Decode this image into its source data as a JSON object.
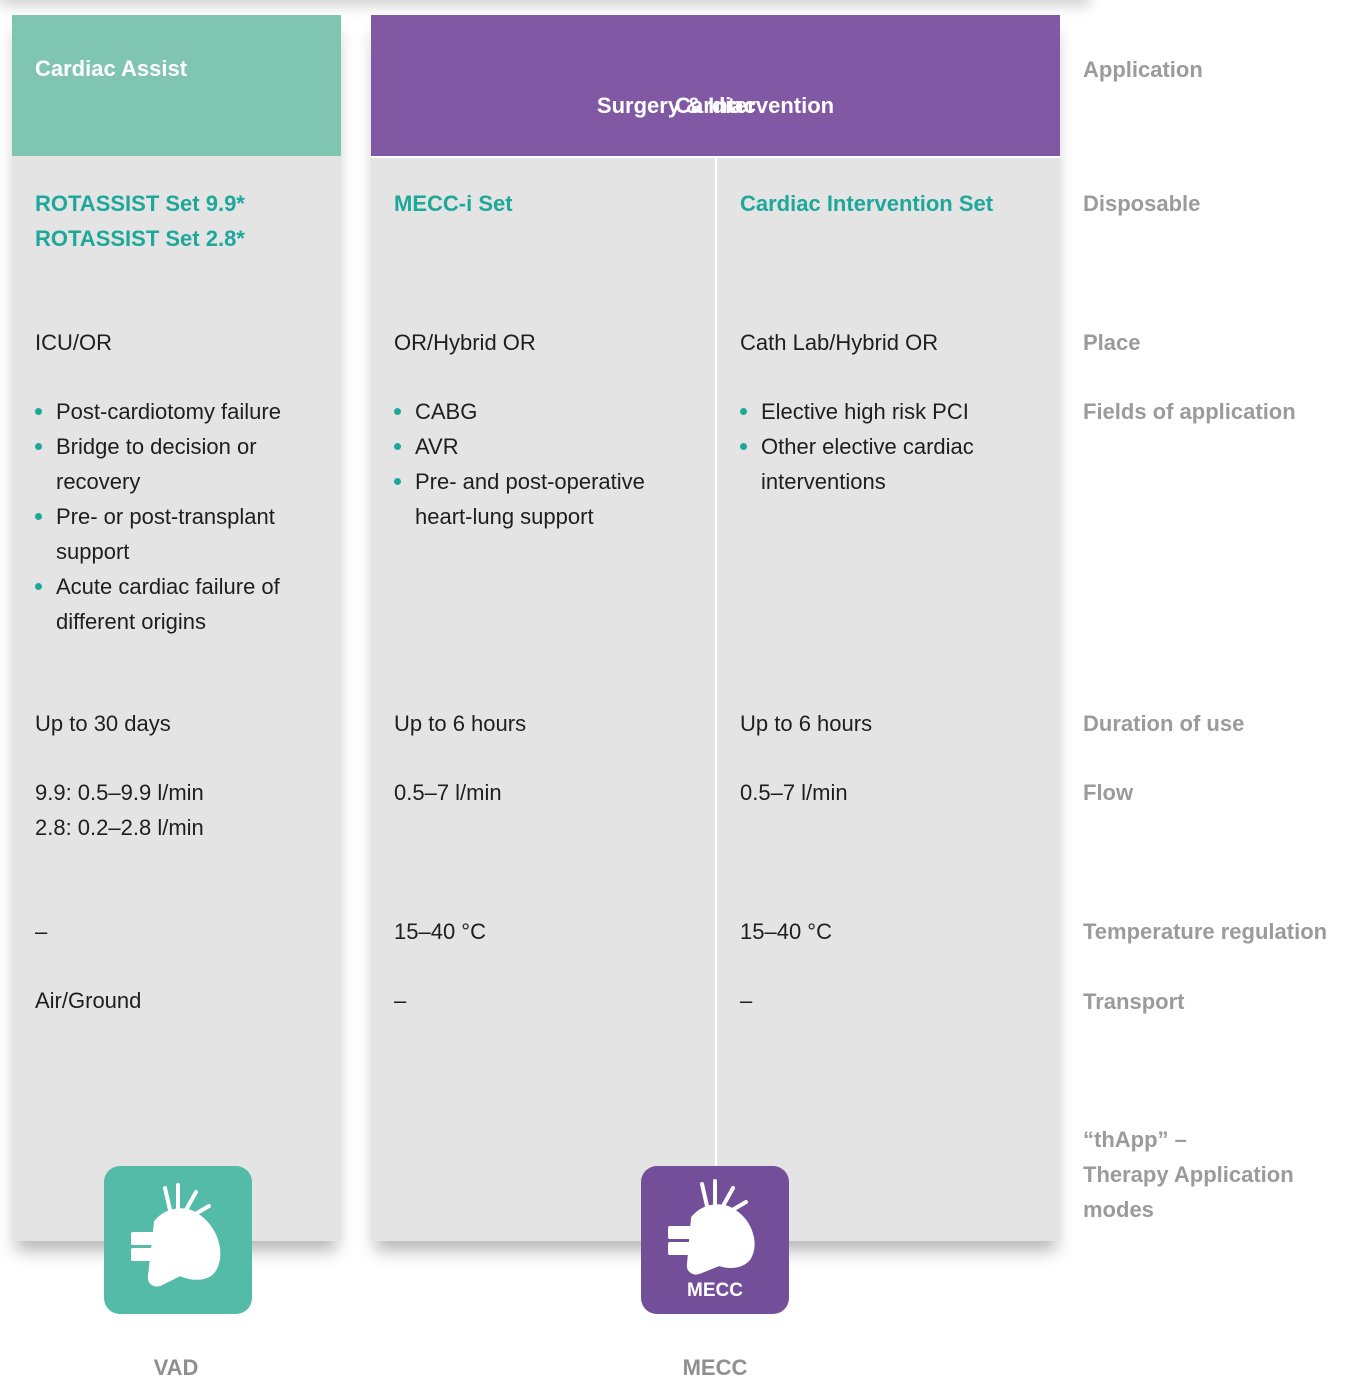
{
  "columns": [
    {
      "application": "Cardiac Assist",
      "disposable": [
        "ROTASSIST Set 9.9*",
        "ROTASSIST Set 2.8*"
      ],
      "place": "ICU/OR",
      "fields": [
        "Post-cardiotomy failure",
        "Bridge to decision or recovery",
        "Pre- or post-transplant support",
        "Acute cardiac failure of different origins"
      ],
      "duration": "Up to 30 days",
      "flow": [
        "9.9: 0.5–9.9 l/min",
        "2.8: 0.2–2.8 l/min"
      ],
      "temperature": "–",
      "transport": "Air/Ground"
    },
    {
      "disposable": [
        "MECC-i Set"
      ],
      "place": "OR/Hybrid OR",
      "fields": [
        "CABG",
        "AVR",
        "Pre- and post-operative heart-lung support"
      ],
      "duration": "Up to 6 hours",
      "flow": [
        "0.5–7 l/min"
      ],
      "temperature": "15–40 °C",
      "transport": "–"
    },
    {
      "disposable": [
        "Cardiac Intervention Set"
      ],
      "place": "Cath Lab/Hybrid OR",
      "fields": [
        "Elective high risk PCI",
        "Other elective cardiac interventions"
      ],
      "duration": "Up to 6 hours",
      "flow": [
        "0.5–7 l/min"
      ],
      "temperature": "15–40 °C",
      "transport": "–"
    }
  ],
  "surgery_header": {
    "line1": "Cardiac",
    "line2": "Surgery & Intervention"
  },
  "row_labels": {
    "application": "Application",
    "disposable": "Disposable",
    "place": "Place",
    "fields": "Fields of application",
    "duration": "Duration of use",
    "flow": "Flow",
    "temperature": "Temperature regulation",
    "transport": "Transport",
    "thapp": [
      "“thApp” –",
      "Therapy Application",
      "modes"
    ]
  },
  "modes": [
    {
      "label": "VAD",
      "icon": "heart-icon",
      "color": "#55bba9"
    },
    {
      "label": "MECC",
      "icon": "heart-icon",
      "icon_text": "MECC",
      "color": "#744f99"
    }
  ],
  "colors": {
    "assist_header": "#80c5b2",
    "surgery_header": "#8058a3",
    "accent": "#1ea89a",
    "label_gray": "#9b9b9b",
    "panel_bg": "#e4e4e4"
  }
}
